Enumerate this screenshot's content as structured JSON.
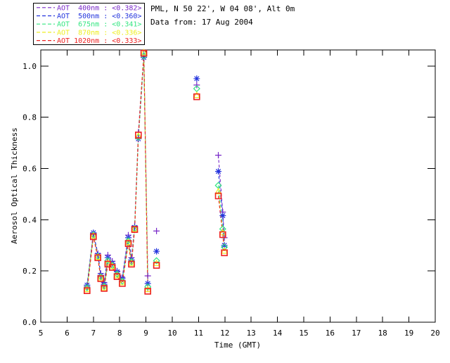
{
  "header": {
    "line1": "PML, N 50 22', W 04 08', Alt 0m",
    "line2": "Data from: 17 Aug 2004"
  },
  "chart_data": {
    "type": "line",
    "title": "",
    "xlabel": "Time (GMT)",
    "ylabel": "Aerosol Optical Thickness",
    "xlim": [
      5,
      20
    ],
    "ylim": [
      0.0,
      1.063
    ],
    "grid": false,
    "legend_position": "top-left",
    "legend_separator": " : ",
    "xtick_labels": [
      "5",
      "6",
      "7",
      "8",
      "9",
      "10",
      "11",
      "12",
      "13",
      "14",
      "15",
      "16",
      "17",
      "18",
      "19",
      "20"
    ],
    "xtick_values": [
      5,
      6,
      7,
      8,
      9,
      10,
      11,
      12,
      13,
      14,
      15,
      16,
      17,
      18,
      19,
      20
    ],
    "ytick_labels": [
      "0.0",
      "0.2",
      "0.4",
      "0.6",
      "0.8",
      "1.0"
    ],
    "ytick_values": [
      0.0,
      0.2,
      0.4,
      0.6,
      0.8,
      1.0
    ],
    "x": [
      6.76,
      7.0,
      7.17,
      7.28,
      7.41,
      7.55,
      7.72,
      7.9,
      8.1,
      8.33,
      8.45,
      8.57,
      8.71,
      8.92,
      9.07,
      9.4,
      10.93,
      11.75,
      11.92,
      11.98
    ],
    "line_segments": [
      [
        0,
        14
      ],
      [
        17,
        19
      ]
    ],
    "line_style": "dashed",
    "series": [
      {
        "name": "AOT  400nm",
        "wavelength": "400nm",
        "avg_label": "<0.382>",
        "color": "#7828c8",
        "marker": "plus",
        "values": [
          0.14,
          0.346,
          0.268,
          0.19,
          0.155,
          0.262,
          0.238,
          0.2,
          0.175,
          0.34,
          0.252,
          0.376,
          0.742,
          1.046,
          0.181,
          0.356,
          0.926,
          0.652,
          0.43,
          0.33
        ]
      },
      {
        "name": "AOT  500nm",
        "wavelength": "500nm",
        "avg_label": "<0.360>",
        "color": "#2233dd",
        "marker": "asterisk",
        "values": [
          0.145,
          0.349,
          0.262,
          0.183,
          0.148,
          0.252,
          0.23,
          0.197,
          0.17,
          0.33,
          0.243,
          0.37,
          0.716,
          1.034,
          0.151,
          0.277,
          0.951,
          0.589,
          0.416,
          0.3
        ]
      },
      {
        "name": "AOT  675nm",
        "wavelength": "675nm",
        "avg_label": "<0.341>",
        "color": "#33e680",
        "marker": "diamond",
        "values": [
          0.135,
          0.341,
          0.257,
          0.177,
          0.14,
          0.24,
          0.222,
          0.188,
          0.16,
          0.318,
          0.236,
          0.366,
          0.722,
          1.04,
          0.138,
          0.24,
          0.912,
          0.534,
          0.364,
          0.293
        ]
      },
      {
        "name": "AOT  870nm",
        "wavelength": "870nm",
        "avg_label": "<0.336>",
        "color": "#eeee22",
        "marker": "triangle",
        "values": [
          0.128,
          0.337,
          0.254,
          0.173,
          0.135,
          0.232,
          0.218,
          0.182,
          0.155,
          0.312,
          0.231,
          0.364,
          0.727,
          1.053,
          0.128,
          0.23,
          0.886,
          0.51,
          0.35,
          0.278
        ]
      },
      {
        "name": "AOT 1020nm",
        "wavelength": "1020nm",
        "avg_label": "<0.333>",
        "color": "#ee2222",
        "marker": "square",
        "values": [
          0.123,
          0.334,
          0.252,
          0.17,
          0.132,
          0.227,
          0.214,
          0.178,
          0.151,
          0.307,
          0.227,
          0.362,
          0.731,
          1.05,
          0.121,
          0.222,
          0.88,
          0.493,
          0.342,
          0.271
        ]
      }
    ]
  },
  "colors": {
    "axis": "#000000",
    "background": "#ffffff",
    "text": "#000000"
  }
}
